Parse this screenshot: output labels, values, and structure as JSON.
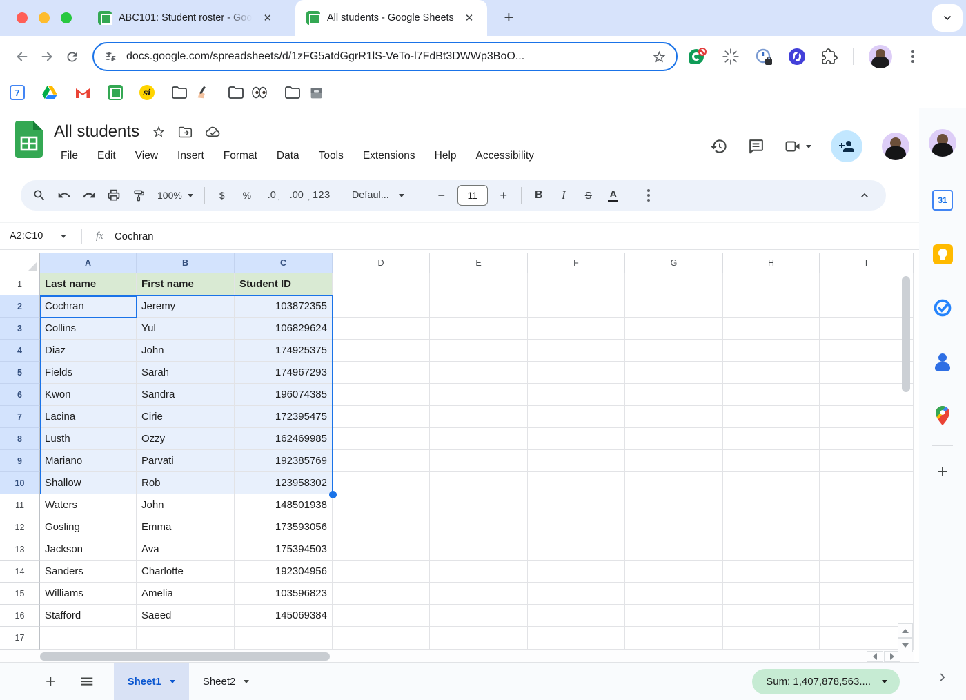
{
  "browser": {
    "tabs": [
      {
        "title": "ABC101: Student roster - Goo",
        "active": false
      },
      {
        "title": "All students - Google Sheets",
        "active": true
      }
    ],
    "url": "docs.google.com/spreadsheets/d/1zFG5atdGgrR1lS-VeTo-l7FdBt3DWWp3BoO..."
  },
  "header": {
    "title": "All students",
    "menus": [
      "File",
      "Edit",
      "View",
      "Insert",
      "Format",
      "Data",
      "Tools",
      "Extensions",
      "Help",
      "Accessibility"
    ]
  },
  "toolbar": {
    "zoom_level": "100%",
    "currency": "$",
    "percent": "%",
    "decrease_decimal": ".0",
    "increase_decimal": ".00",
    "number_format": "123",
    "font_name": "Defaul...",
    "font_size": "11",
    "bold": "B",
    "italic": "I",
    "strikethrough": "S",
    "text_color": "A"
  },
  "formula_bar": {
    "name_box": "A2:C10",
    "fx_label": "fx",
    "value": "Cochran"
  },
  "grid": {
    "column_letters": [
      "A",
      "B",
      "C",
      "D",
      "E",
      "F",
      "G",
      "H",
      "I"
    ],
    "selected_columns": [
      "A",
      "B",
      "C"
    ],
    "headers": [
      "Last name",
      "First name",
      "Student ID"
    ],
    "students": [
      [
        "Cochran",
        "Jeremy",
        "103872355"
      ],
      [
        "Collins",
        "Yul",
        "106829624"
      ],
      [
        "Diaz",
        "John",
        "174925375"
      ],
      [
        "Fields",
        "Sarah",
        "174967293"
      ],
      [
        "Kwon",
        "Sandra",
        "196074385"
      ],
      [
        "Lacina",
        "Cirie",
        "172395475"
      ],
      [
        "Lusth",
        "Ozzy",
        "162469985"
      ],
      [
        "Mariano",
        "Parvati",
        "192385769"
      ],
      [
        "Shallow",
        "Rob",
        "123958302"
      ],
      [
        "Waters",
        "John",
        "148501938"
      ],
      [
        "Gosling",
        "Emma",
        "173593056"
      ],
      [
        "Jackson",
        "Ava",
        "175394503"
      ],
      [
        "Sanders",
        "Charlotte",
        "192304956"
      ],
      [
        "Williams",
        "Amelia",
        "103596823"
      ],
      [
        "Stafford",
        "Saeed",
        "145069384"
      ]
    ],
    "selection": {
      "range": "A2:C10",
      "active_cell": "A2",
      "first_selected_row": 2,
      "last_selected_row": 10
    },
    "total_rows_visible": 17
  },
  "sheet_tabs": [
    {
      "label": "Sheet1",
      "active": true
    },
    {
      "label": "Sheet2",
      "active": false
    }
  ],
  "status_bar": {
    "sum": "Sum: 1,407,878,563...."
  },
  "colors": {
    "accent_blue": "#1a73e8",
    "selection_fill": "#e8f0fc",
    "selected_header_blue": "#d3e3fd",
    "table_header_green": "#d9ead3",
    "sum_pill_green": "#c6ebd3",
    "sheets_green": "#34a853",
    "chrome_bg": "#d7e3fb",
    "toolbar_pill": "#edf2fa"
  }
}
